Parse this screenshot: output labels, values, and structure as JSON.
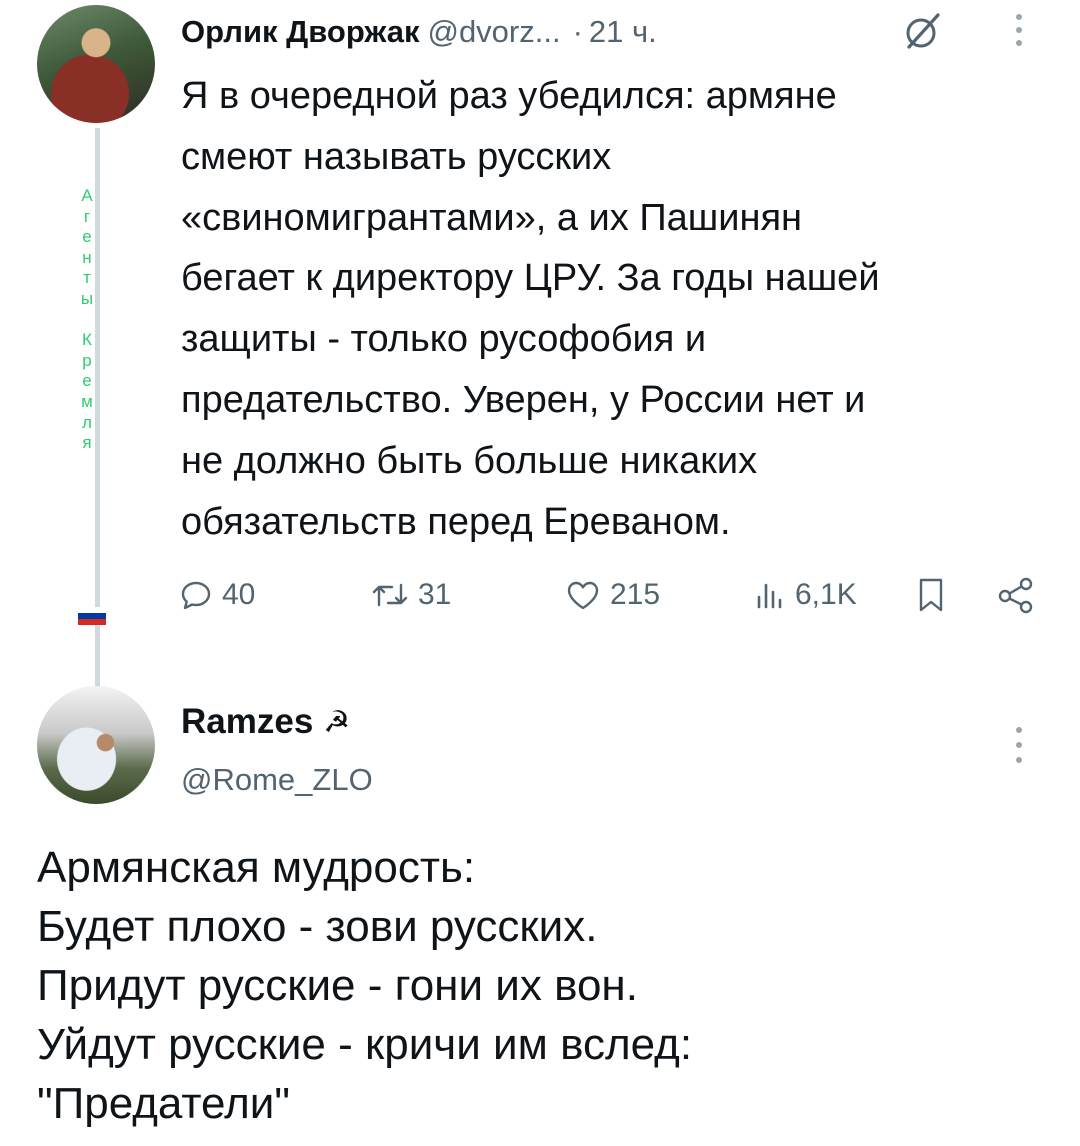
{
  "tweet1": {
    "author_name": "Орлик Дворжак",
    "handle": "@dvorz...",
    "separator": "·",
    "time": "21 ч.",
    "side_label": [
      "А",
      "г",
      "е",
      "н",
      "т",
      "ы",
      " ",
      "К",
      "р",
      "е",
      "м",
      "л",
      "я"
    ],
    "text": "Я в очередной раз убедился: армяне\nсмеют называть русских\n«свиномигрантами», а их Пашинян\nбегает к директору ЦРУ. За годы нашей\nзащиты - только русофобия и\nпредательство. Уверен, у России нет и\nне должно быть больше никаких\nобязательств перед Ереваном.",
    "stats": {
      "replies": "40",
      "reposts": "31",
      "likes": "215",
      "views": "6,1K"
    },
    "icons": {
      "grok": "grok-icon",
      "more": "more-vertical-icon",
      "reply": "reply-icon",
      "repost": "repost-icon",
      "like": "heart-icon",
      "views": "views-chart-icon",
      "bookmark": "bookmark-icon",
      "share": "share-icon"
    },
    "flag_colors": [
      "#ffffff",
      "#0039a6",
      "#d52b1e"
    ]
  },
  "tweet2": {
    "author_name": "Ramzes",
    "name_emoji": "☭",
    "handle": "@Rome_ZLO",
    "text": "Армянская мудрость:\nБудет плохо - зови русских.\nПридут русские - гони их вон.\nУйдут русские - кричи им вслед:\n\"Предатели\""
  },
  "colors": {
    "text_primary": "#0f1419",
    "text_secondary": "#536471",
    "thread_line": "#cfd9de",
    "side_label": "#2ecc71"
  }
}
